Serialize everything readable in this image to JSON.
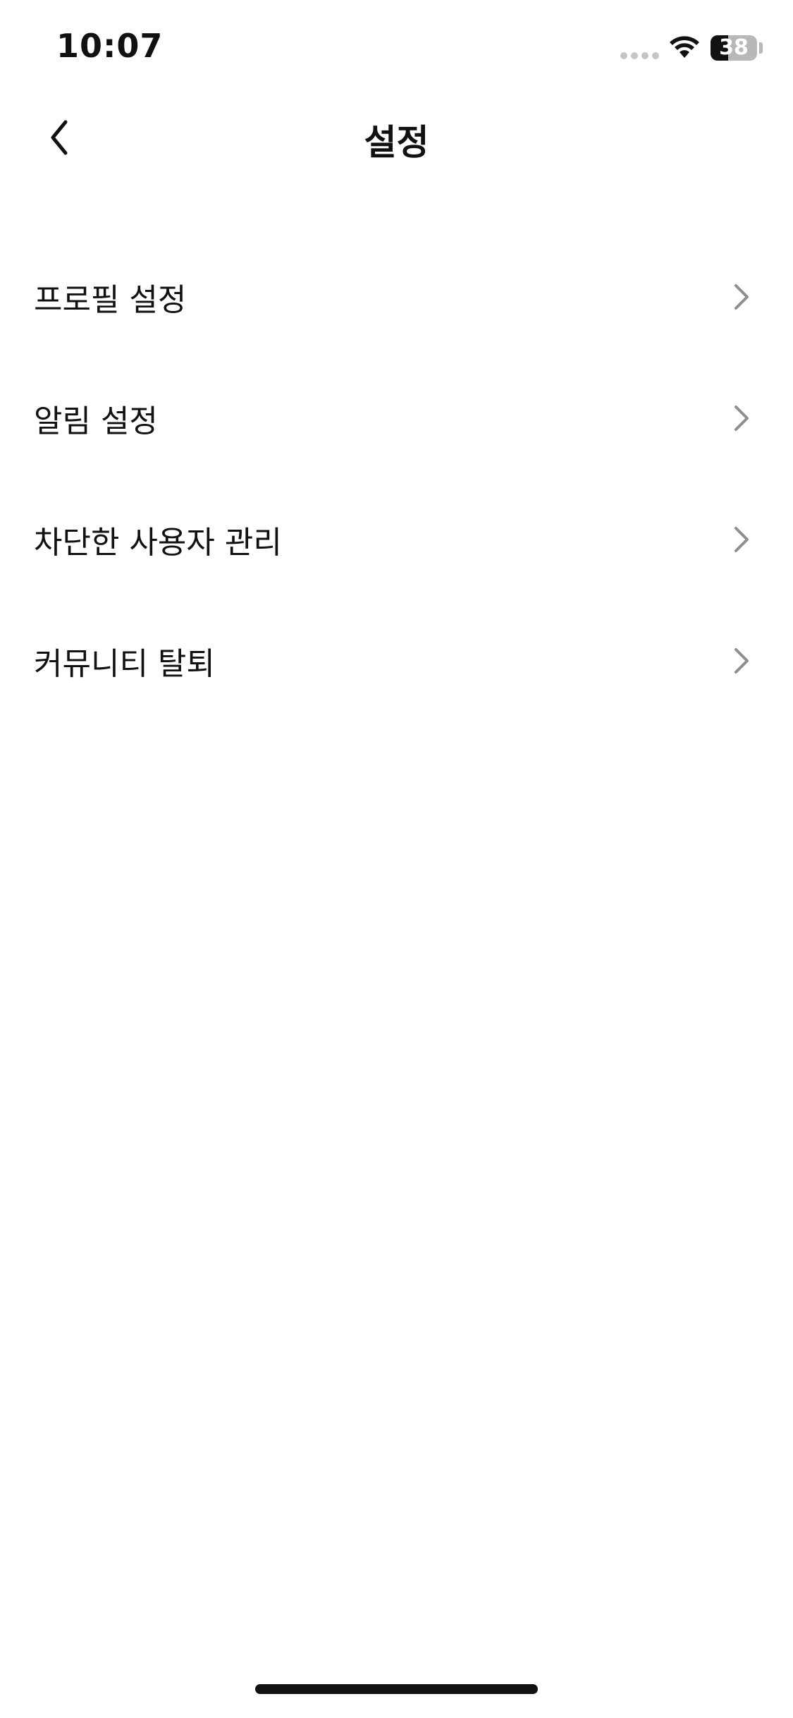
{
  "status_bar": {
    "time": "10:07",
    "battery_level": "38",
    "battery_fraction": 0.38
  },
  "nav": {
    "title": "설정",
    "back_icon": "chevron-left-icon"
  },
  "menu": {
    "items": [
      {
        "label": "프로필 설정",
        "icon": "chevron-right-icon"
      },
      {
        "label": "알림 설정",
        "icon": "chevron-right-icon"
      },
      {
        "label": "차단한 사용자 관리",
        "icon": "chevron-right-icon"
      },
      {
        "label": "커뮤니티 탈퇴",
        "icon": "chevron-right-icon"
      }
    ]
  },
  "colors": {
    "background": "#ffffff",
    "text": "#111111",
    "chevron": "#8e8e8e"
  }
}
